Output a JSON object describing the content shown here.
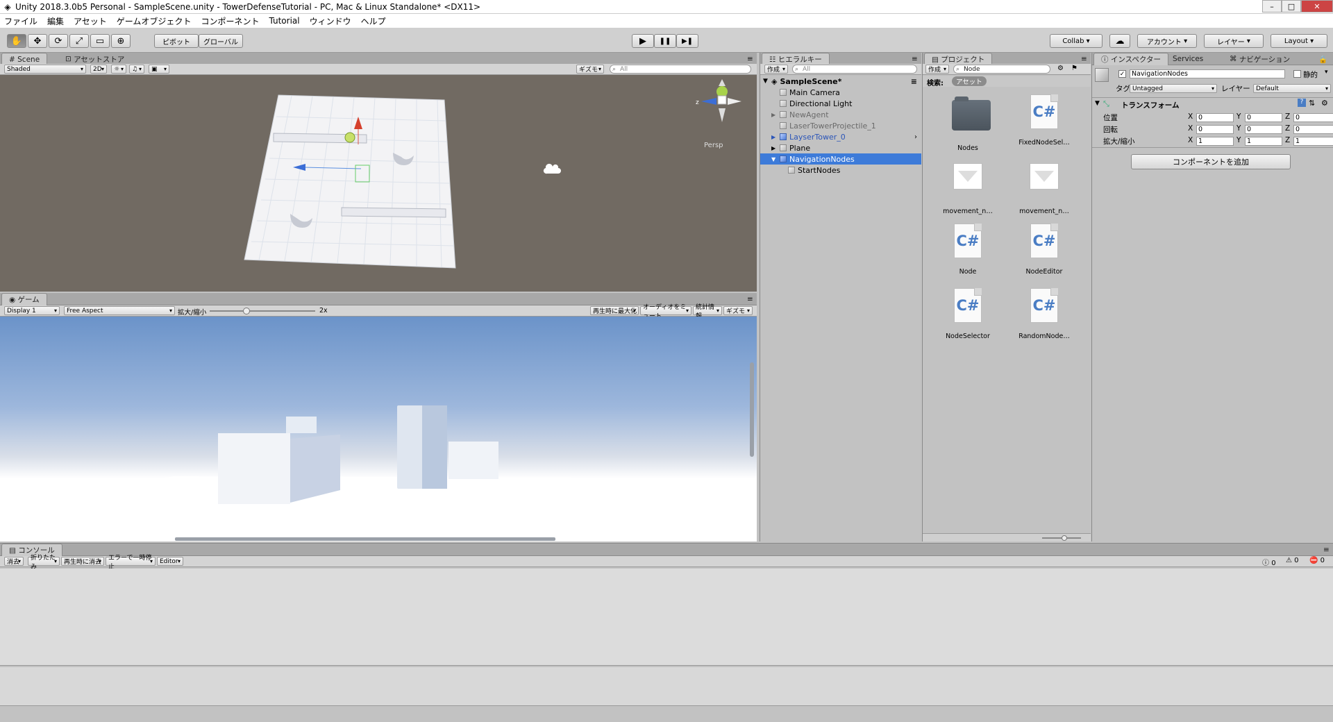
{
  "window": {
    "title": "Unity 2018.3.0b5 Personal - SampleScene.unity - TowerDefenseTutorial - PC, Mac & Linux Standalone* <DX11>",
    "min": "–",
    "max": "□",
    "close": "✕"
  },
  "menu": [
    "ファイル",
    "編集",
    "アセット",
    "ゲームオブジェクト",
    "コンポーネント",
    "Tutorial",
    "ウィンドウ",
    "ヘルプ"
  ],
  "toolbar": {
    "tools": [
      "✋",
      "✥",
      "⟳",
      "⤢",
      "▭",
      "⊕"
    ],
    "pivot": "ピボット",
    "global": "グローバル",
    "play": "▶",
    "pause": "❚❚",
    "step": "▶❚",
    "collab": "Collab",
    "cloud": "☁",
    "account": "アカウント",
    "layers": "レイヤー",
    "layout": "Layout"
  },
  "scene": {
    "tab": "Scene",
    "tab2": "アセットストア",
    "shading": "Shaded",
    "mode2d": "2D",
    "light": "☼",
    "audio": "♫",
    "fx": "▣",
    "gizmos": "ギズモ",
    "search": "All",
    "persp": "Persp"
  },
  "game": {
    "tab": "ゲーム",
    "display": "Display 1",
    "aspect": "Free Aspect",
    "scale_label": "拡大/縮小",
    "scale_value": "2x",
    "scale_level": 0.35,
    "maximize": "再生時に最大化",
    "mute": "オーディオをミュート",
    "stats": "統計情報",
    "gizmos": "ギズモ"
  },
  "hierarchy": {
    "tab": "ヒエラルキー",
    "create": "作成",
    "search": "All",
    "scene": "SampleScene*",
    "items": [
      {
        "label": "Main Camera",
        "indent": 1,
        "arrow": "",
        "prefab": false,
        "selected": false
      },
      {
        "label": "Directional Light",
        "indent": 1,
        "arrow": "",
        "prefab": false,
        "selected": false
      },
      {
        "label": "NewAgent",
        "indent": 1,
        "arrow": "▶",
        "prefab": false,
        "selected": false,
        "dim": true
      },
      {
        "label": "LaserTowerProjectile_1",
        "indent": 1,
        "arrow": "",
        "prefab": false,
        "selected": false,
        "dim": true
      },
      {
        "label": "LayserTower_0",
        "indent": 1,
        "arrow": "▶",
        "prefab": true,
        "selected": false
      },
      {
        "label": "Plane",
        "indent": 1,
        "arrow": "▶",
        "prefab": false,
        "selected": false
      },
      {
        "label": "NavigationNodes",
        "indent": 1,
        "arrow": "▼",
        "prefab": false,
        "selected": true
      },
      {
        "label": "StartNodes",
        "indent": 2,
        "arrow": "",
        "prefab": false,
        "selected": false
      }
    ]
  },
  "project": {
    "tab": "プロジェクト",
    "create": "作成",
    "search": "Node",
    "filter_label": "検索:",
    "filter_value": "アセット",
    "assets": [
      {
        "name": "Nodes",
        "kind": "folder"
      },
      {
        "name": "FixedNodeSel…",
        "kind": "cs"
      },
      {
        "name": "movement_n…",
        "kind": "shape"
      },
      {
        "name": "movement_n…",
        "kind": "shape"
      },
      {
        "name": "Node",
        "kind": "cs"
      },
      {
        "name": "NodeEditor",
        "kind": "cs"
      },
      {
        "name": "NodeSelector",
        "kind": "cs"
      },
      {
        "name": "RandomNode…",
        "kind": "cs"
      }
    ],
    "cs_glyph": "C#"
  },
  "inspector": {
    "tab": "インスペクター",
    "tab2": "Services",
    "tab3": "ナビゲーション",
    "object_name": "NavigationNodes",
    "static_label": "静的",
    "tag_label": "タグ",
    "tag_value": "Untagged",
    "layer_label": "レイヤー",
    "layer_value": "Default",
    "transform_label": "トランスフォーム",
    "rows": [
      {
        "label": "位置",
        "x": "0",
        "y": "0",
        "z": "0"
      },
      {
        "label": "回転",
        "x": "0",
        "y": "0",
        "z": "0"
      },
      {
        "label": "拡大/縮小",
        "x": "1",
        "y": "1",
        "z": "1"
      }
    ],
    "axis": [
      "X",
      "Y",
      "Z"
    ],
    "add_component": "コンポーネントを追加"
  },
  "console": {
    "tab": "コンソール",
    "clear": "消去",
    "collapse": "折りたたみ",
    "clear_on_play": "再生時に消去",
    "error_pause": "エラーで一時停止",
    "editor": "Editor",
    "info_count": "0",
    "warn_count": "0",
    "error_count": "0"
  }
}
